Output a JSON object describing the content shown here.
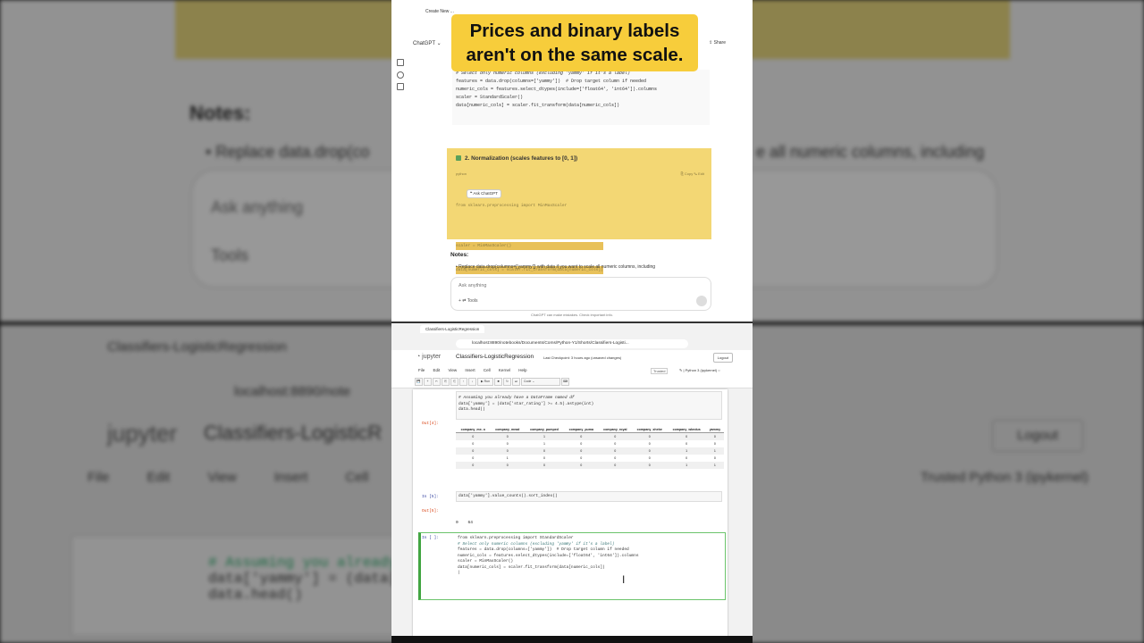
{
  "background": {
    "notes_heading": "Notes:",
    "bullet_text": "• Replace data.drop(co",
    "bullet_right": "e all numeric columns, including",
    "ask_placeholder": "Ask anything",
    "tools_label": "Tools",
    "tab_label": "Classifiers-LogisticRegression",
    "url": "localhost:8890/note",
    "jupyter_logo": "jupyter",
    "notebook_title": "Classifiers-LogisticR",
    "menu": "File Edit View Insert Cell K",
    "kernel": "Trusted   Python 3 (ipykernel)",
    "logout": "Logout",
    "code_lines": [
      "# Assuming you already",
      "data['yammy'] = (data[",
      "data.head()"
    ]
  },
  "caption": {
    "line1": "Prices and binary labels",
    "line2": "aren't on the same scale."
  },
  "chatgpt": {
    "tab": "Create New ...",
    "title": "ChatGPT ⌄",
    "share": "⇪ Share",
    "code_lines": [
      "# Select only numeric columns (excluding 'yammy' if it's a label)",
      "features = data.drop(columns=['yammy'])  # Drop target column if needed",
      "numeric_cols = features.select_dtypes(include=['float64', 'int64']).columns",
      "",
      "scaler = StandardScaler()",
      "data[numeric_cols] = scaler.fit_transform(data[numeric_cols])"
    ],
    "norm_heading": "2. Normalization (scales features to [0, 1])",
    "norm_lang": "python",
    "norm_copy": "⎘ Copy  ✎ Edit",
    "norm_code": [
      "from sklearn.preprocessing import MinMaxScaler",
      "",
      "scaler = MinMaxScaler()",
      "data[numeric_cols] = scaler.fit_transform(data[numeric_cols])"
    ],
    "ask_chatgpt": "❝ Ask ChatGPT",
    "notes_heading": "Notes:",
    "notes_bullet": "• Replace  data.drop(columns=['yammy'])  with  data  if you want to scale all numeric columns, including",
    "ask_placeholder": "Ask anything",
    "tools": "+   ⇄ Tools",
    "disclaimer": "ChatGPT can make mistakes. Check important info."
  },
  "jupyter": {
    "tab": "Classifiers-LogisticRegression",
    "url": "localhost:8890/notebooks/Documents/Coms/Python-Y1/Shorts/Classifiers-Logisti...",
    "logo": "◔ jupyter",
    "title": "Classifiers-LogisticRegression",
    "checkpoint": "Last Checkpoint: 3 hours ago  (unsaved changes)",
    "logout": "Logout",
    "menu": "File Edit View Insert Cell Kernel Help",
    "trusted": "Trusted",
    "kernel": "✎ | Python 3 (ipykernel) ○",
    "toolbar": [
      "💾",
      "+",
      "✂",
      "⎘",
      "⎗",
      "↑",
      "↓",
      "▶ Run",
      "■",
      "↻",
      "⏭",
      "Code ⌄",
      "⌨"
    ],
    "cell1_lines": [
      "# Assuming you already have a DataFrame named df",
      "data['yammy'] = (data['star_rating'] >= 4.5).astype(int)",
      "data.head()"
    ],
    "out4_prompt": "Out[4]:",
    "table_headers": [
      "company_me-\no",
      "company_mead",
      "company_pumped",
      "company_puma",
      "company_royal",
      "company_shebe",
      "company_wkndus",
      "yammy"
    ],
    "table_rows": [
      [
        "0",
        "0",
        "1",
        "0",
        "0",
        "0",
        "0",
        "0"
      ],
      [
        "0",
        "0",
        "1",
        "0",
        "0",
        "0",
        "0",
        "0"
      ],
      [
        "0",
        "0",
        "0",
        "0",
        "0",
        "0",
        "1",
        "1"
      ],
      [
        "0",
        "1",
        "0",
        "0",
        "0",
        "0",
        "0",
        "0"
      ],
      [
        "0",
        "0",
        "0",
        "0",
        "0",
        "0",
        "1",
        "1"
      ]
    ],
    "in5_prompt": "In [5]:",
    "cell2": "data['yammy'].value_counts().sort_index()",
    "out5_prompt": "Out[5]:",
    "out5_lines": [
      "0    64",
      "1    57",
      "Name: yammy, dtype: int64"
    ],
    "in_prompt": "In [ ]:",
    "cell3_lines": [
      "from sklearn.preprocessing import StandardScaler",
      "",
      "# Select only numeric columns (excluding 'yammy' if it's a label)",
      "features = data.drop(columns=['yammy'])  # Drop target column if needed",
      "numeric_cols = features.select_dtypes(include=['float64', 'int64']).columns",
      "",
      "scaler = MinMaxScaler()",
      "data[numeric_cols] = scaler.fit_transform(data[numeric_cols])",
      "|"
    ]
  }
}
